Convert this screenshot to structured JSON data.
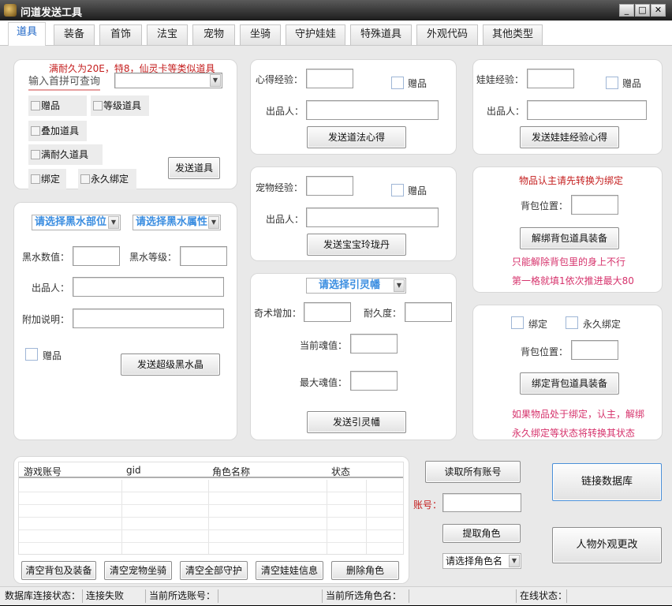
{
  "window": {
    "title": "问道发送工具",
    "min": "_",
    "max": "□",
    "close": "✕"
  },
  "tabs": [
    "道具",
    "装备",
    "首饰",
    "法宝",
    "宠物",
    "坐骑",
    "守护娃娃",
    "特殊道具",
    "外观代码",
    "其他类型"
  ],
  "item_panel": {
    "note": "满耐久为20E，特8，仙灵卡等类似道具",
    "search_label": "输入首拼可查询",
    "options": [
      "赠品",
      "等级道具",
      "叠加道具",
      "满耐久道具",
      "绑定",
      "永久绑定"
    ],
    "send_button": "发送道具"
  },
  "heart_panel": {
    "exp_label": "心得经验：",
    "gift": "赠品",
    "producer_label": "出品人：",
    "send_button": "发送道法心得"
  },
  "doll_panel": {
    "exp_label": "娃娃经验：",
    "gift": "赠品",
    "producer_label": "出品人：",
    "send_button": "发送娃娃经验心得"
  },
  "pet_panel": {
    "exp_label": "宠物经验：",
    "gift": "赠品",
    "producer_label": "出品人：",
    "send_button": "发送宝宝玲珑丹"
  },
  "unbind_panel": {
    "note": "物品认主请先转换为绑定",
    "bag_label": "背包位置：",
    "button": "解绑背包道具装备",
    "hint1": "只能解除背包里的身上不行",
    "hint2": "第一格就填1依次推进最大80"
  },
  "black_panel": {
    "part_select": "请选择黑水部位",
    "attr_select": "请选择黑水属性",
    "value_label": "黑水数值：",
    "level_label": "黑水等级：",
    "producer_label": "出品人：",
    "note_label": "附加说明：",
    "gift": "赠品",
    "send_button": "发送超级黑水晶"
  },
  "banner_panel": {
    "select": "请选择引灵幡",
    "qishu_label": "奇术增加：",
    "durability_label": "耐久度：",
    "cur_soul_label": "当前魂值：",
    "max_soul_label": "最大魂值：",
    "send_button": "发送引灵幡"
  },
  "bind_panel": {
    "bind": "绑定",
    "perm_bind": "永久绑定",
    "bag_label": "背包位置：",
    "button": "绑定背包道具装备",
    "hint1": "如果物品处于绑定，认主，解绑",
    "hint2": "永久绑定等状态将转换其状态"
  },
  "account_table": {
    "columns": [
      "游戏账号",
      "gid",
      "角色名称",
      "状态"
    ]
  },
  "bottom_buttons": [
    "清空背包及装备",
    "清空宠物坐骑",
    "清空全部守护",
    "清空娃娃信息",
    "删除角色"
  ],
  "account_ops": {
    "read_all": "读取所有账号",
    "account_label": "账号：",
    "fetch_role": "提取角色",
    "role_select": "请选择角色名",
    "connect_db": "链接数据库",
    "change_look": "人物外观更改"
  },
  "status_bar": {
    "db_label": "数据库连接状态：",
    "db_value": "连接失败",
    "acct_label": "当前所选账号：",
    "role_label": "当前所选角色名：",
    "online_label": "在线状态："
  }
}
